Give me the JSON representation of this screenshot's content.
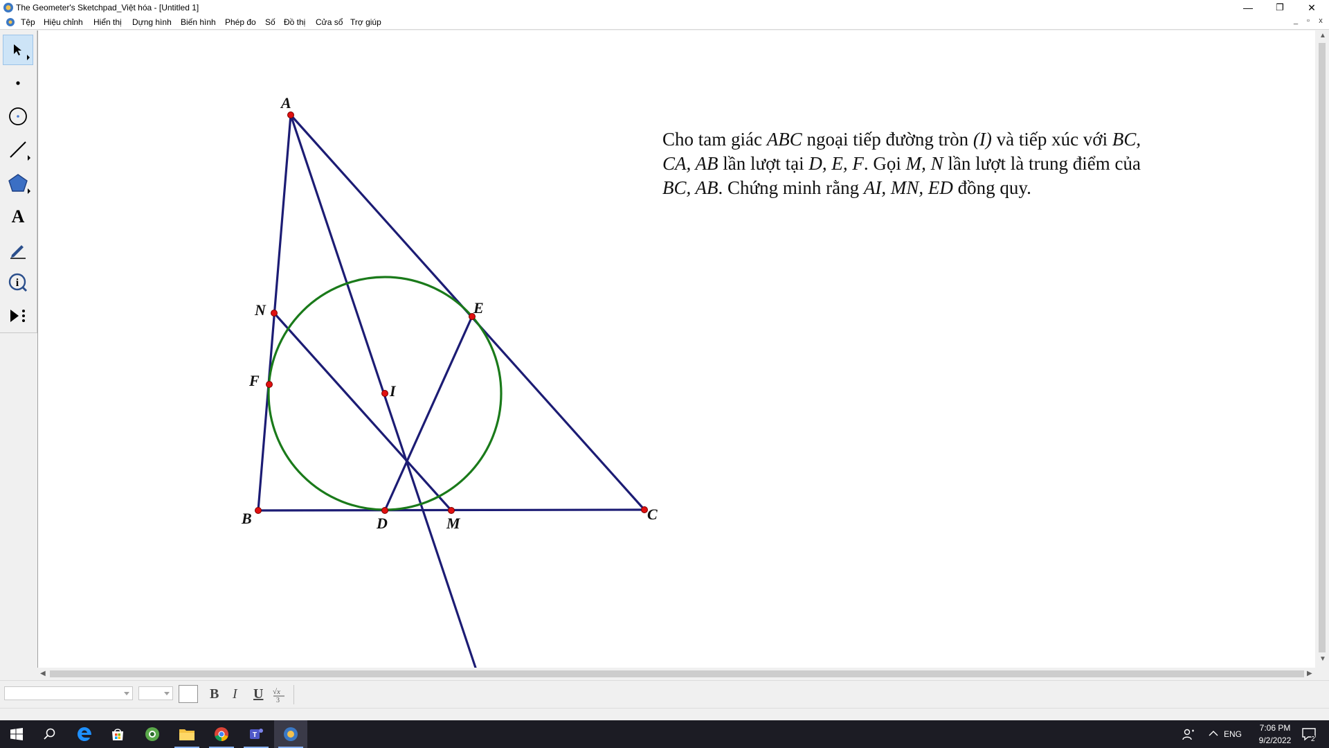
{
  "window": {
    "title": "The Geometer's Sketchpad_Việt hóa - [Untitled 1]",
    "controls": {
      "minimize": "—",
      "restore": "❐",
      "close": "✕"
    },
    "mdi_controls": {
      "minimize": "_",
      "restore": "▫",
      "close": "x"
    }
  },
  "menu": {
    "items": [
      "Tệp",
      "Hiệu chỉnh",
      "Hiển thị",
      "Dựng hình",
      "Biến hình",
      "Phép đo",
      "Số",
      "Đồ thị",
      "Cửa sổ",
      "Trợ giúp"
    ]
  },
  "toolbox": {
    "tools": [
      "selection-arrow",
      "point",
      "compass",
      "straightedge",
      "polygon",
      "text",
      "marker",
      "information",
      "custom"
    ],
    "selected": "selection-arrow"
  },
  "problem": {
    "l1_a": "Cho tam giác ",
    "l1_b": "ABC",
    "l1_c": " ngoại tiếp đường tròn ",
    "l1_d": "(I)",
    "l1_e": " và tiếp xúc với ",
    "l1_f": "BC,",
    "l2_a": "CA, AB",
    "l2_b": " lần lượt tại ",
    "l2_c": "D, E, F",
    "l2_d": ". Gọi ",
    "l2_e": "M, N",
    "l2_f": " lần lượt là trung điểm của",
    "l3_a": "BC, AB",
    "l3_b": ". Chứng minh rằng ",
    "l3_c": "AI, MN, ED",
    "l3_d": " đồng quy."
  },
  "figure": {
    "points": {
      "A": "A",
      "B": "B",
      "C": "C",
      "D": "D",
      "E": "E",
      "F": "F",
      "I": "I",
      "M": "M",
      "N": "N"
    },
    "colors": {
      "segment": "#1c1c74",
      "circle": "#1a7a1a",
      "point": "#e01010"
    }
  },
  "format_bar": {
    "font_name": "",
    "font_size": "",
    "bold": "B",
    "italic": "I",
    "underline": "U",
    "math_icon": "math-format-icon"
  },
  "taskbar": {
    "apps": [
      "start-icon",
      "search-icon",
      "edge-icon",
      "store-icon",
      "cốc-cốc-icon",
      "file-explorer-icon",
      "chrome-icon",
      "teams-icon",
      "sketchpad-icon"
    ],
    "language": "ENG",
    "time": "7:06 PM",
    "date": "9/2/2022",
    "notifications": "2"
  }
}
